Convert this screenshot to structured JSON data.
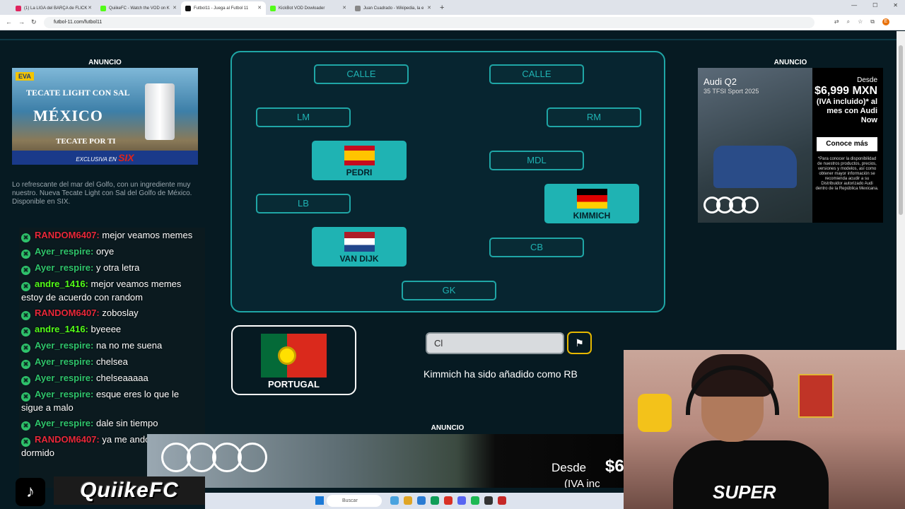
{
  "browser": {
    "tabs": [
      {
        "label": "(1) La LIGA del BARÇA de FLICK",
        "color": "#e0245e",
        "active": false
      },
      {
        "label": "QuiikeFC - Watch the VOD on K",
        "color": "#53fc18",
        "active": false
      },
      {
        "label": "Futbol11 - Juega al Futbol 11",
        "color": "#111111",
        "active": true
      },
      {
        "label": "KickBot VOD Dowloader",
        "color": "#53fc18",
        "active": false
      },
      {
        "label": "Juan Cuadrado - Wikipedia, la e",
        "color": "#888888",
        "active": false
      }
    ],
    "new_tab": "+",
    "url": "futbol-11.com/futbol11",
    "profile_initial": "E"
  },
  "ads": {
    "left_label": "ANUNCIO",
    "right_label": "ANUNCIO",
    "bottom_label": "ANUNCIO",
    "left": {
      "brand": "EVA",
      "line1": "TECATE LIGHT CON SAL",
      "line2": "MÉXICO",
      "line3": "TECATE POR TI",
      "bottom": "EXCLUSIVA EN",
      "store": "SIX",
      "description": "Lo refrescante del mar del Golfo, con un ingrediente muy nuestro. Nueva Tecate Light con Sal del Golfo de México. Disponible en SIX."
    },
    "right": {
      "model": "Audi Q2",
      "sub": "35 TFSI Sport 2025",
      "desde": "Desde",
      "price": "$6,999 MXN",
      "iva": "(IVA incluido)* al mes con Audi Now",
      "cta": "Conoce más",
      "fine": "*Para conocer la disponibilidad de nuestros productos, precios, versiones y modelos, así como obtener mayor información se recomienda acudir a su Distribuidor autorizado Audi dentro de la República Mexicana."
    },
    "bottom": {
      "desde": "Desde",
      "price": "$6",
      "iva": "(IVA inc"
    }
  },
  "pitch": {
    "slots": {
      "st1": "CALLE",
      "st2": "CALLE",
      "lm": "LM",
      "rm": "RM",
      "mdl": "MDL",
      "lb": "LB",
      "cb": "CB",
      "gk": "GK"
    },
    "players": {
      "pedri": "PEDRI",
      "kimmich": "KIMMICH",
      "vandijk": "VAN DIJK"
    }
  },
  "country": {
    "name": "PORTUGAL"
  },
  "guess_input": {
    "value": "Cl"
  },
  "status_message": "Kimmich ha sido añadido como RB",
  "chat": [
    {
      "user": "RANDOM6407:",
      "text": "mejor veamos memes",
      "color": "#e8283a"
    },
    {
      "user": "Ayer_respire:",
      "text": "orye",
      "color": "#2fc56d"
    },
    {
      "user": "Ayer_respire:",
      "text": "y otra letra",
      "color": "#2fc56d"
    },
    {
      "user": "andre_1416:",
      "text": "mejor veamos memes estoy de acuerdo con random",
      "color": "#53fc18"
    },
    {
      "user": "RANDOM6407:",
      "text": "zoboslay",
      "color": "#e8283a"
    },
    {
      "user": "andre_1416:",
      "text": "byeeee",
      "color": "#53fc18"
    },
    {
      "user": "Ayer_respire:",
      "text": "na no me suena",
      "color": "#2fc56d"
    },
    {
      "user": "Ayer_respire:",
      "text": "chelsea",
      "color": "#2fc56d"
    },
    {
      "user": "Ayer_respire:",
      "text": "chelseaaaaa",
      "color": "#2fc56d"
    },
    {
      "user": "Ayer_respire:",
      "text": "esque eres lo que le sigue a malo",
      "color": "#2fc56d"
    },
    {
      "user": "Ayer_respire:",
      "text": "dale sin tiempo",
      "color": "#2fc56d"
    },
    {
      "user": "RANDOM6407:",
      "text": "ya me ando quedando dormido",
      "color": "#e8283a"
    }
  ],
  "overlay": {
    "brand": "QuiikeFC",
    "shirt_text": "SUPER"
  },
  "taskbar": {
    "search_placeholder": "Buscar"
  }
}
